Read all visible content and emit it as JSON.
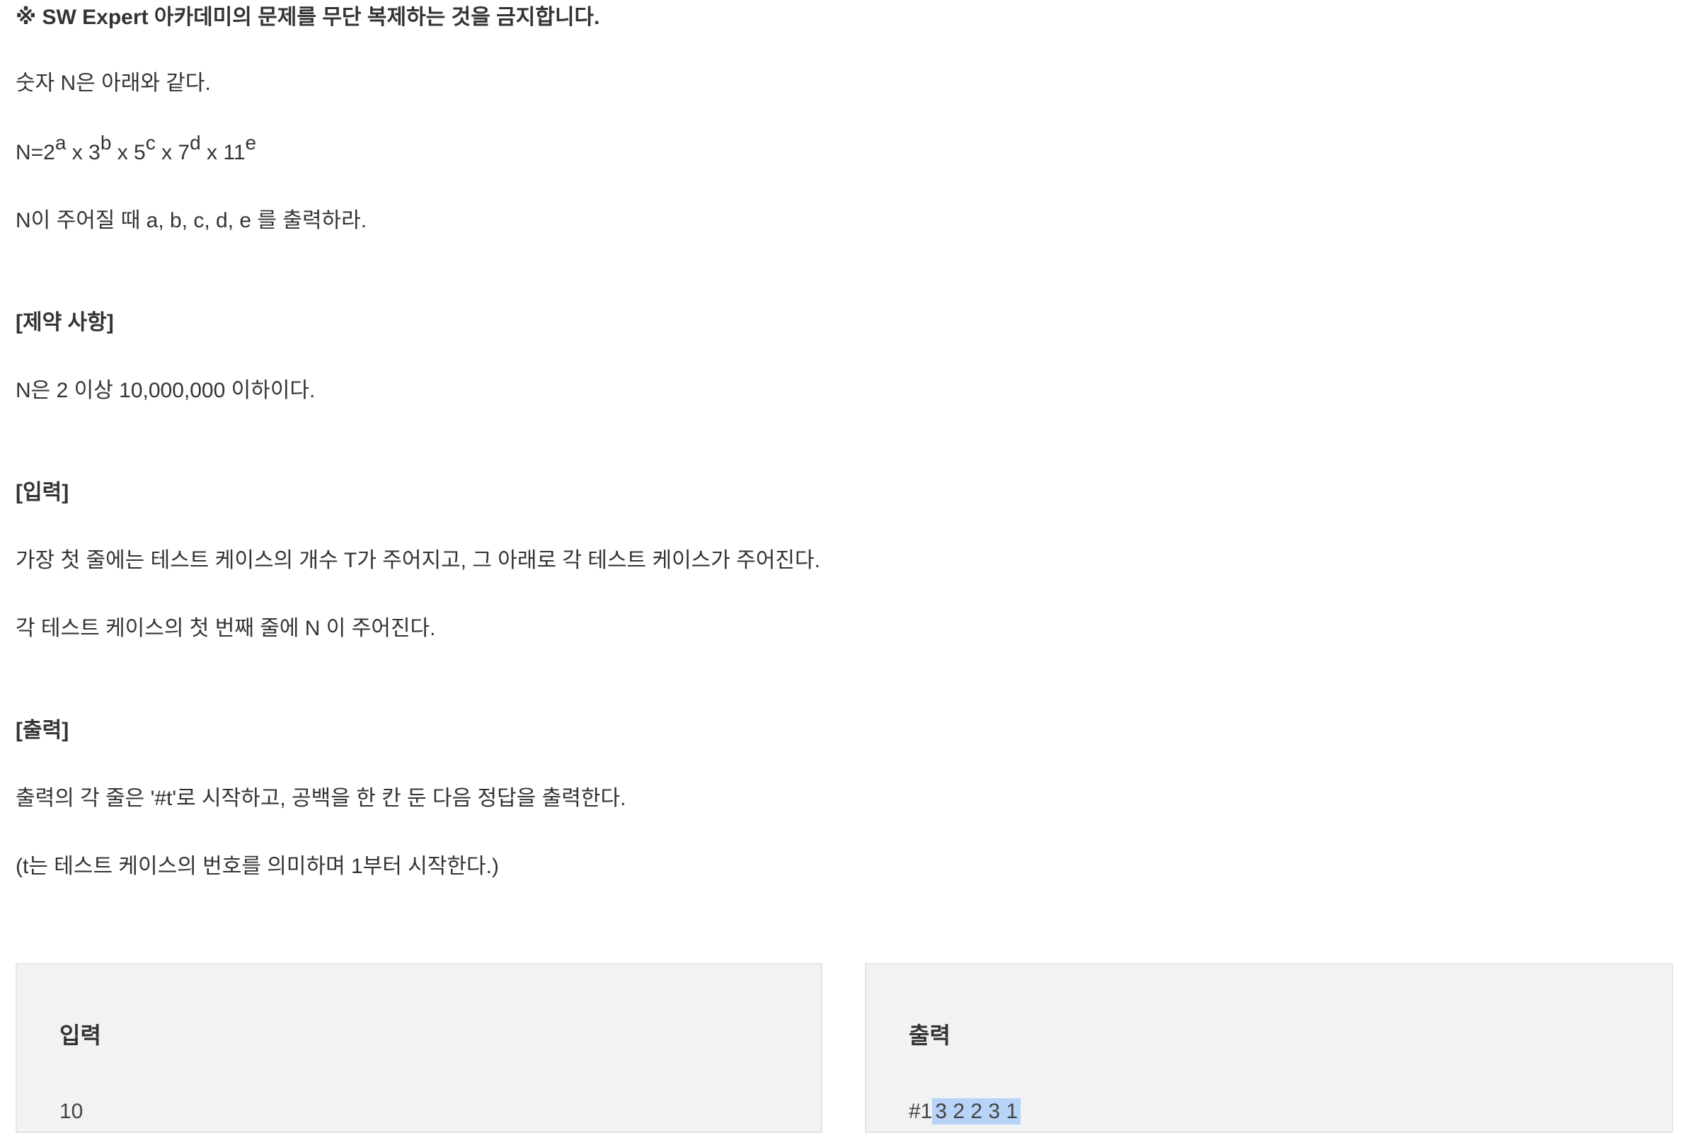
{
  "notice": "※ SW Expert 아카데미의 문제를 무단 복제하는 것을 금지합니다.",
  "intro": "숫자 N은 아래와 같다.",
  "formula": {
    "prefix": "N=2",
    "exp_a": "a",
    "t2": " x 3",
    "exp_b": "b",
    "t3": " x 5",
    "exp_c": "c",
    "t4": " x 7",
    "exp_d": "d",
    "t5": " x 11",
    "exp_e": "e"
  },
  "task": "N이 주어질 때 a, b, c, d, e 를 출력하라.",
  "constraints": {
    "heading": "[제약 사항]",
    "text": "N은 2 이상 10,000,000 이하이다."
  },
  "input_section": {
    "heading": "[입력]",
    "line1": "가장 첫 줄에는 테스트 케이스의 개수 T가 주어지고, 그 아래로 각 테스트 케이스가 주어진다.",
    "line2": "각 테스트 케이스의 첫 번째 줄에 N 이 주어진다."
  },
  "output_section": {
    "heading": "[출력]",
    "line1": "출력의 각 줄은 '#t'로 시작하고, 공백을 한 칸 둔 다음 정답을 출력한다.",
    "line2": "(t는 테스트 케이스의 번호를 의미하며 1부터 시작한다.)"
  },
  "sample_input": {
    "title": "입력",
    "first_line": "10"
  },
  "sample_output": {
    "title": "출력",
    "prefix": "#1",
    "highlighted": "3 2 2 3 1"
  }
}
